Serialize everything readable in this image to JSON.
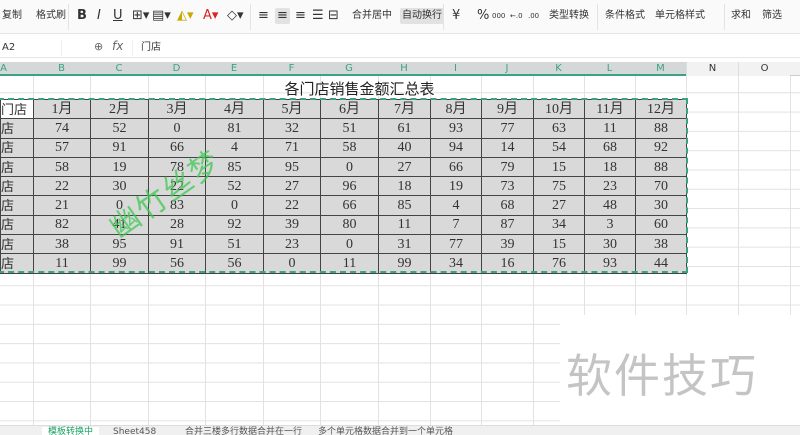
{
  "toolbar": {
    "copy": "复制",
    "format_painter": "格式刷",
    "bold": "B",
    "italic": "I",
    "underline": "U",
    "merge_center": "合并居中",
    "wrap_text": "自动换行",
    "currency": "¥",
    "percent": "%",
    "thousands": "000",
    "dec_inc": "←.0",
    "dec_dec": ".00",
    "type_convert": "类型转换",
    "cond_format": "条件格式",
    "cell_style": "单元格样式",
    "sum": "求和",
    "filter": "筛选"
  },
  "formula_bar": {
    "name_box": "A2",
    "fx": "fx",
    "value": "门店"
  },
  "columns": [
    "A",
    "B",
    "C",
    "D",
    "E",
    "F",
    "G",
    "H",
    "I",
    "J",
    "K",
    "L",
    "M",
    "N",
    "O"
  ],
  "sheet": {
    "title": "各门店销售金额汇总表",
    "header": [
      "门店",
      "1月",
      "2月",
      "3月",
      "4月",
      "5月",
      "6月",
      "7月",
      "8月",
      "9月",
      "10月",
      "11月",
      "12月"
    ],
    "rows": [
      [
        "店",
        74,
        52,
        0,
        81,
        32,
        51,
        61,
        93,
        77,
        63,
        11,
        88
      ],
      [
        "店",
        57,
        91,
        66,
        4,
        71,
        58,
        40,
        94,
        14,
        54,
        68,
        92
      ],
      [
        "店",
        58,
        19,
        78,
        85,
        95,
        0,
        27,
        66,
        79,
        15,
        18,
        88
      ],
      [
        "店",
        22,
        30,
        22,
        52,
        27,
        96,
        18,
        19,
        73,
        75,
        23,
        70
      ],
      [
        "店",
        21,
        0,
        83,
        0,
        22,
        66,
        85,
        4,
        68,
        27,
        48,
        30
      ],
      [
        "店",
        82,
        41,
        28,
        92,
        39,
        80,
        11,
        7,
        87,
        34,
        3,
        60
      ],
      [
        "店",
        38,
        95,
        91,
        51,
        23,
        0,
        31,
        77,
        39,
        15,
        30,
        38
      ],
      [
        "店",
        11,
        99,
        56,
        56,
        0,
        11,
        99,
        34,
        16,
        76,
        93,
        44
      ]
    ]
  },
  "watermarks": {
    "green": "幽竹丝梦",
    "gray": "软件技巧"
  },
  "tabs": [
    "模板转换中",
    "Sheet458",
    "合并三楼多行数据合并在一行",
    "多个单元格数据合并到一个单元格"
  ],
  "colors": {
    "accent": "#3aa383",
    "cell_fill": "#d9d9d9"
  }
}
